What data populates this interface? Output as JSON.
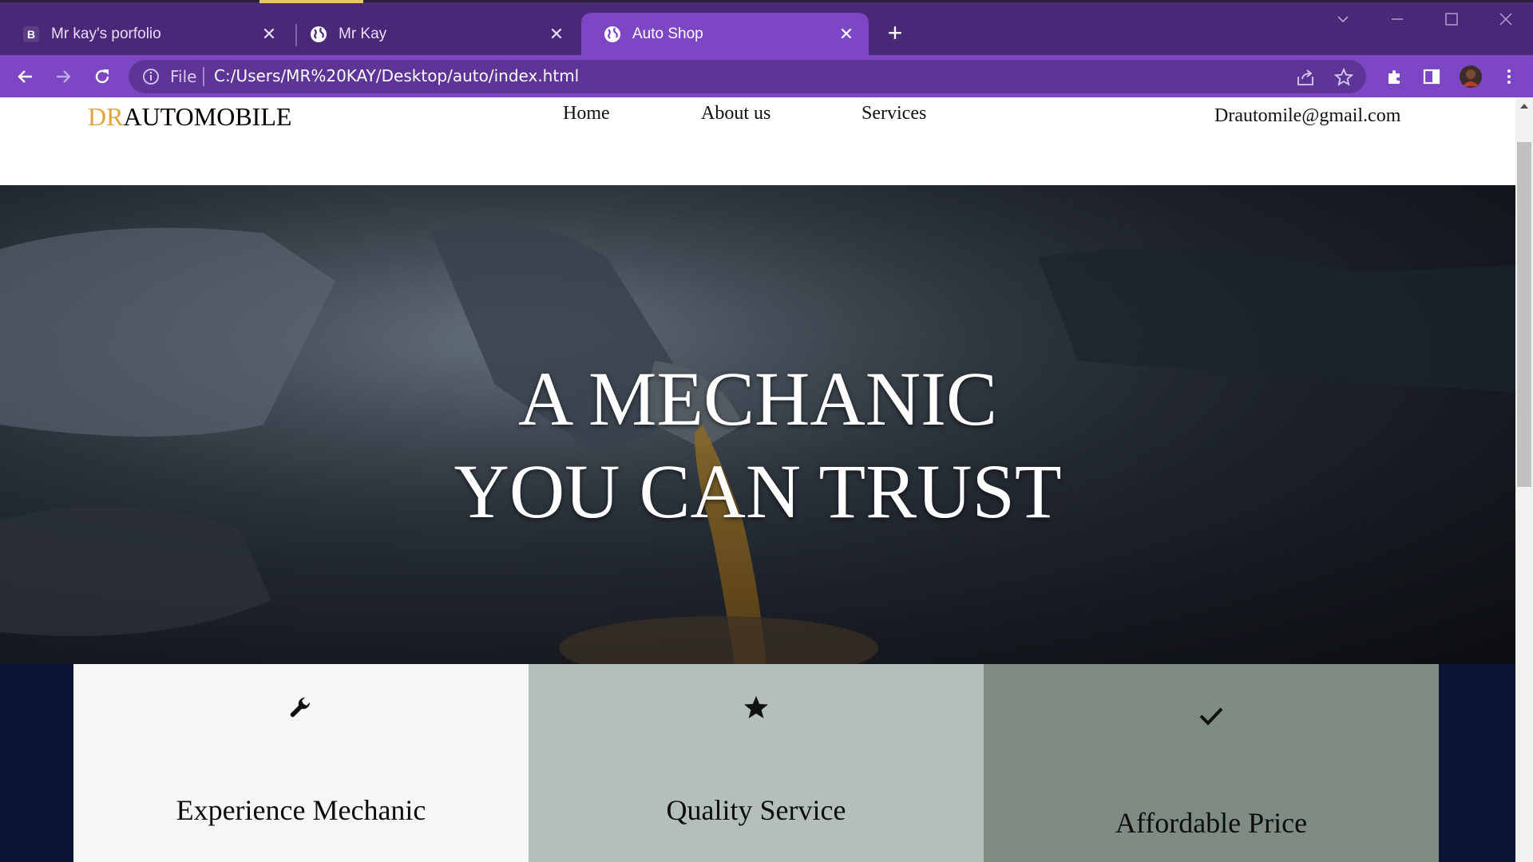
{
  "browser": {
    "tabs": [
      {
        "favicon": "B",
        "title": "Mr kay's porfolio",
        "active": false
      },
      {
        "favicon": "globe-icon",
        "title": "Mr Kay",
        "active": false
      },
      {
        "favicon": "globe-icon",
        "title": "Auto Shop",
        "active": true
      }
    ],
    "address": {
      "scheme_label": "File",
      "url": "C:/Users/MR%20KAY/Desktop/auto/index.html"
    },
    "colors": {
      "tabstrip": "#4b2778",
      "toolbar": "#7c46c4",
      "omnibox": "#5e3597"
    }
  },
  "site": {
    "logo": {
      "accent": "DR",
      "rest": "AUTOMOBILE",
      "accent_color": "#e1a53a"
    },
    "nav": [
      {
        "label": "Home"
      },
      {
        "label": "About us"
      },
      {
        "label": "Services"
      }
    ],
    "email": "Drautomile@gmail.com",
    "hero": {
      "line1": "A MECHANIC",
      "line2": "YOU CAN TRUST"
    },
    "features": [
      {
        "icon": "wrench-icon",
        "caption": "Experience Mechanic",
        "bg": "#f5f6f8"
      },
      {
        "icon": "star-icon",
        "caption": "Quality Service",
        "bg": "#b3bfb8"
      },
      {
        "icon": "checkmark-icon",
        "caption": "Affordable Price",
        "bg": "#7e8c84"
      }
    ]
  }
}
